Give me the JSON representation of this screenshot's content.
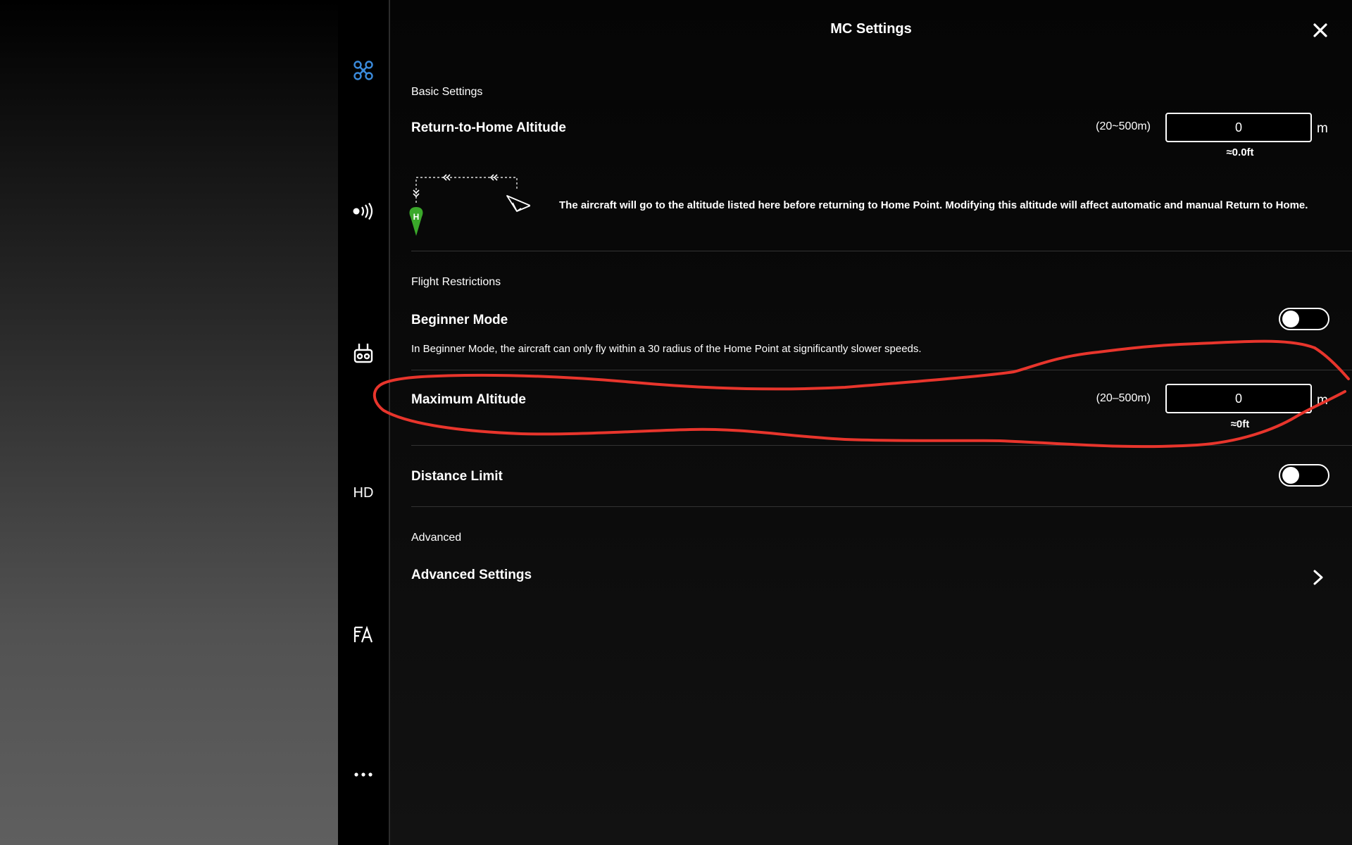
{
  "header": {
    "title": "MC Settings"
  },
  "sidebar": {
    "items": [
      {
        "icon": "aircraft-icon",
        "active": true
      },
      {
        "icon": "signal-icon"
      },
      {
        "icon": "remote-controller-icon"
      },
      {
        "icon": "hd-transmission",
        "label": "HD"
      },
      {
        "icon": "flight-log-icon"
      },
      {
        "icon": "more-icon"
      }
    ]
  },
  "basic": {
    "header": "Basic Settings",
    "rth": {
      "label": "Return-to-Home Altitude",
      "range": "(20~500m)",
      "value": "0",
      "unit": "m",
      "converted": "≈0.0ft",
      "home_marker": "H",
      "description": "The aircraft will go to the altitude listed here before returning to Home Point. Modifying this altitude will affect automatic and manual Return to Home."
    }
  },
  "restrictions": {
    "header": "Flight Restrictions",
    "beginner": {
      "label": "Beginner Mode",
      "enabled": false,
      "description": "In Beginner Mode, the aircraft can only fly within a 30 radius of the Home Point at significantly slower speeds."
    },
    "max_altitude": {
      "label": "Maximum Altitude",
      "range": "(20–500m)",
      "value": "0",
      "unit": "m",
      "converted": "≈0ft"
    },
    "distance_limit": {
      "label": "Distance Limit",
      "enabled": false
    }
  },
  "advanced": {
    "header": "Advanced",
    "settings_label": "Advanced Settings"
  },
  "colors": {
    "accent": "#3b8bdc",
    "home_marker": "#3aa82a",
    "annotation": "#e8352c"
  }
}
